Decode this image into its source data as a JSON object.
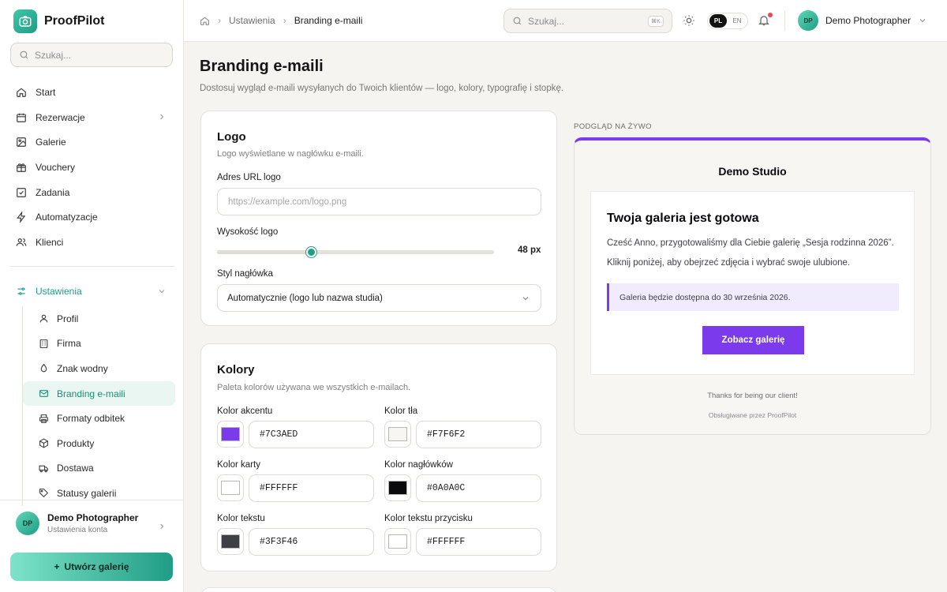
{
  "app": {
    "name": "ProofPilot"
  },
  "sidebar": {
    "search_placeholder": "Szukaj...",
    "items": [
      {
        "label": "Start",
        "icon": "home-icon"
      },
      {
        "label": "Rezerwacje",
        "icon": "calendar-icon"
      },
      {
        "label": "Galerie",
        "icon": "image-icon"
      },
      {
        "label": "Vouchery",
        "icon": "gift-icon"
      },
      {
        "label": "Zadania",
        "icon": "checkbox-icon"
      },
      {
        "label": "Automatyzacje",
        "icon": "bolt-icon"
      },
      {
        "label": "Klienci",
        "icon": "users-icon"
      }
    ],
    "settings_label": "Ustawienia",
    "settings_items": [
      {
        "label": "Profil",
        "icon": "user-icon"
      },
      {
        "label": "Firma",
        "icon": "building-icon"
      },
      {
        "label": "Znak wodny",
        "icon": "droplet-icon"
      },
      {
        "label": "Branding e-maili",
        "icon": "mail-icon"
      },
      {
        "label": "Formaty odbitek",
        "icon": "printer-icon"
      },
      {
        "label": "Produkty",
        "icon": "box-icon"
      },
      {
        "label": "Dostawa",
        "icon": "truck-icon"
      },
      {
        "label": "Statusy galerii",
        "icon": "tag-icon"
      }
    ],
    "user": {
      "initials": "DP",
      "name": "Demo Photographer",
      "sub": "Ustawienia konta"
    },
    "create_button": "Utwórz galerię"
  },
  "topbar": {
    "breadcrumb": [
      "Ustawienia",
      "Branding e-maili"
    ],
    "search_placeholder": "Szukaj...",
    "search_shortcut": "⌘K",
    "lang_active": "PL",
    "lang_other": "EN",
    "user": {
      "initials": "DP",
      "name": "Demo Photographer"
    }
  },
  "page": {
    "title": "Branding e-maili",
    "subtitle": "Dostosuj wygląd e-maili wysyłanych do Twoich klientów — logo, kolory, typografię i stopkę."
  },
  "logo_card": {
    "title": "Logo",
    "subtitle": "Logo wyświetlane w nagłówku e-maili.",
    "url_label": "Adres URL logo",
    "url_placeholder": "https://example.com/logo.png",
    "height_label": "Wysokość logo",
    "height_value": "48 px",
    "height_fraction": 0.34,
    "header_style_label": "Styl nagłówka",
    "header_style_value": "Automatycznie (logo lub nazwa studia)"
  },
  "colors_card": {
    "title": "Kolory",
    "subtitle": "Paleta kolorów używana we wszystkich e-mailach.",
    "fields": [
      {
        "label": "Kolor akcentu",
        "value": "#7C3AED"
      },
      {
        "label": "Kolor tła",
        "value": "#F7F6F2"
      },
      {
        "label": "Kolor karty",
        "value": "#FFFFFF"
      },
      {
        "label": "Kolor nagłówków",
        "value": "#0A0A0C"
      },
      {
        "label": "Kolor tekstu",
        "value": "#3F3F46"
      },
      {
        "label": "Kolor tekstu przycisku",
        "value": "#FFFFFF"
      }
    ]
  },
  "preview": {
    "label": "PODGLĄD NA ŻYWO",
    "studio": "Demo Studio",
    "heading": "Twoja galeria jest gotowa",
    "para1": "Cześć Anno, przygotowaliśmy dla Ciebie galerię „Sesja rodzinna 2026”.",
    "para2": "Kliknij poniżej, aby obejrzeć zdjęcia i wybrać swoje ulubione.",
    "note": "Galeria będzie dostępna do 30 września 2026.",
    "button": "Zobacz galerię",
    "footer1": "Thanks for being our client!",
    "footer2": "Obsługiwane przez ProofPilot"
  }
}
